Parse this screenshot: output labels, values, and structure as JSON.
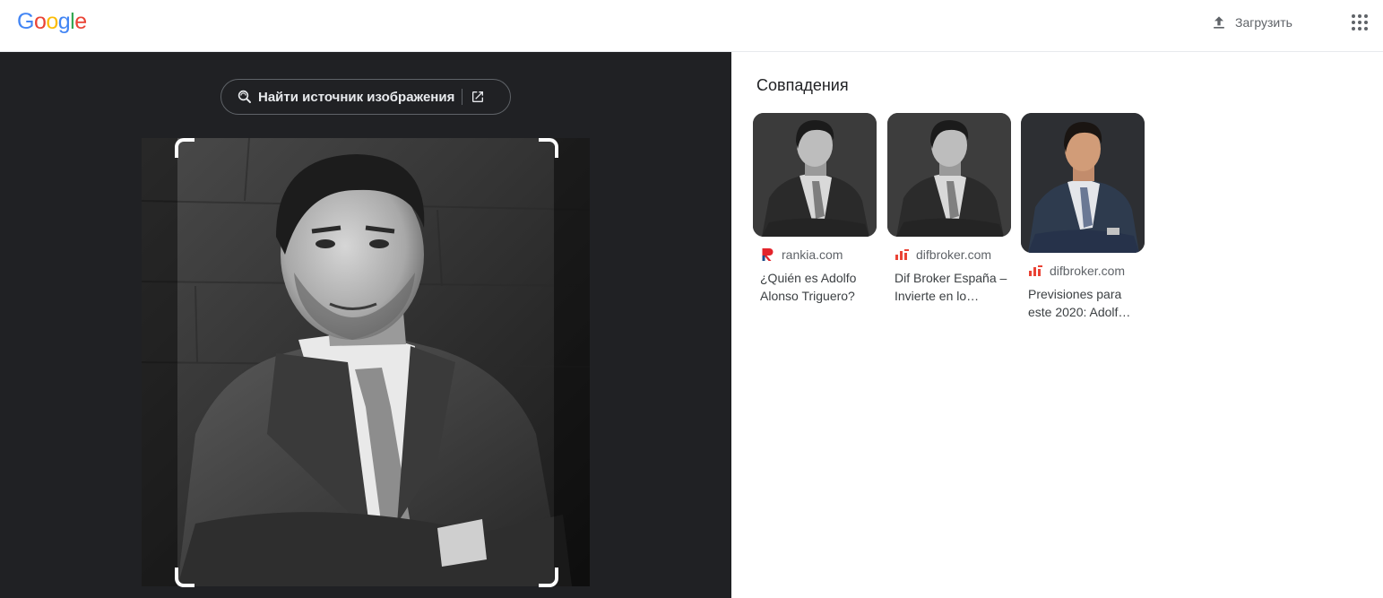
{
  "header": {
    "logo_letters": [
      {
        "ch": "G",
        "color": "#4285F4"
      },
      {
        "ch": "o",
        "color": "#EA4335"
      },
      {
        "ch": "o",
        "color": "#FBBC05"
      },
      {
        "ch": "g",
        "color": "#4285F4"
      },
      {
        "ch": "l",
        "color": "#34A853"
      },
      {
        "ch": "e",
        "color": "#EA4335"
      }
    ],
    "upload_label": "Загрузить",
    "upload_icon": "upload-icon",
    "apps_icon": "apps-grid-icon"
  },
  "viewer": {
    "find_source_label": "Найти источник изображения",
    "lens_icon": "lens-search-icon",
    "open_icon": "open-in-new-icon"
  },
  "results": {
    "title": "Совпадения",
    "items": [
      {
        "site": "rankia.com",
        "site_icon": "rankia-logo-icon",
        "caption": "¿Quién es Adolfo Alonso Triguero?",
        "tone": "bw"
      },
      {
        "site": "difbroker.com",
        "site_icon": "difbroker-logo-icon",
        "caption": "Dif Broker España – Invierte en lo…",
        "tone": "bw"
      },
      {
        "site": "difbroker.com",
        "site_icon": "difbroker-logo-icon",
        "caption": "Previsiones para este 2020: Adolf…",
        "tone": "color"
      }
    ]
  },
  "colors": {
    "dark_bg": "#202124",
    "accent_red": "#EA4335",
    "rankia_red": "#E3242B",
    "rankia_blue": "#1C4E8A"
  }
}
